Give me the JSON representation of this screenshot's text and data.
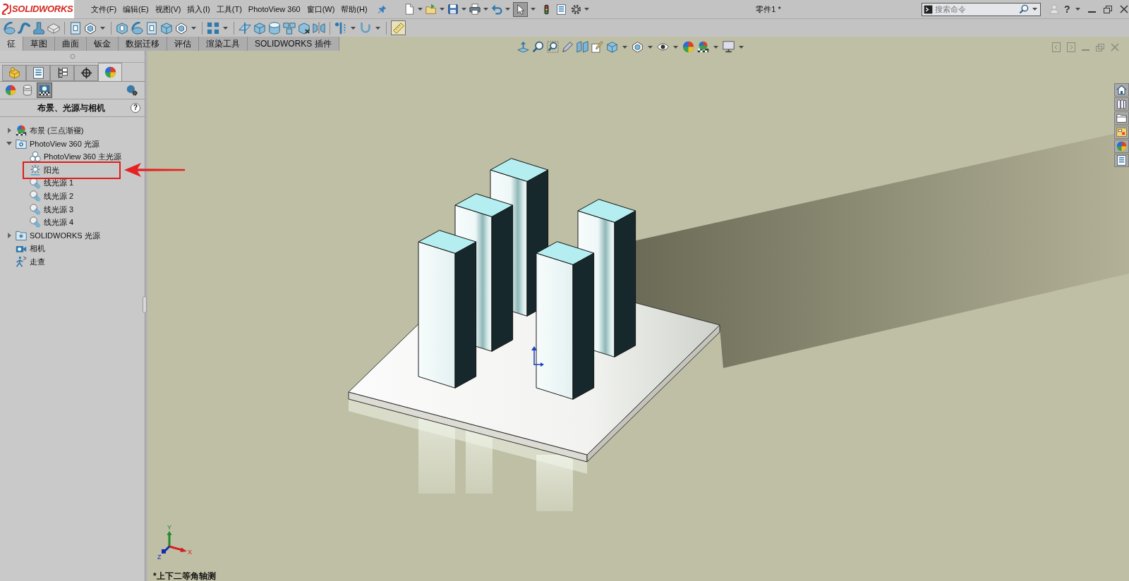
{
  "window": {
    "brand": "SOLIDWORKS",
    "title": "零件1 *"
  },
  "menu": [
    "文件(F)",
    "编辑(E)",
    "视图(V)",
    "插入(I)",
    "工具(T)",
    "PhotoView 360",
    "窗口(W)",
    "帮助(H)"
  ],
  "select_button": {
    "pressed": true
  },
  "search": {
    "placeholder": "搜索命令"
  },
  "help_menu": "?",
  "toggle_button": {
    "pressed": true
  },
  "command_tabs": [
    {
      "label": "征",
      "selected": true
    },
    {
      "label": "草图",
      "selected": false
    },
    {
      "label": "曲面",
      "selected": false
    },
    {
      "label": "钣金",
      "selected": false
    },
    {
      "label": "数据迁移",
      "selected": false
    },
    {
      "label": "评估",
      "selected": false
    },
    {
      "label": "渲染工具",
      "selected": false
    },
    {
      "label": "SOLIDWORKS 插件",
      "selected": false
    }
  ],
  "scene_panel": {
    "tabs": [
      {
        "kind": "feature",
        "selected": false
      },
      {
        "kind": "property",
        "selected": false
      },
      {
        "kind": "configuration",
        "selected": false
      },
      {
        "kind": "dimension",
        "selected": false
      },
      {
        "kind": "display",
        "selected": true
      }
    ],
    "views": [
      {
        "kind": "appearance",
        "selected": false
      },
      {
        "kind": "decal",
        "selected": false
      },
      {
        "kind": "scene",
        "selected": true
      }
    ],
    "title": "布景、光源与相机",
    "help": "?",
    "tree": [
      {
        "label": "布景 (三点渐褪)",
        "kind": "scene",
        "expanded": false,
        "marked": false
      },
      {
        "label": "PhotoView 360 光源",
        "kind": "folder",
        "expanded": true,
        "marked": false,
        "children": [
          {
            "label": "PhotoView 360 主光源",
            "kind": "main_light",
            "marked": false
          },
          {
            "label": "阳光",
            "kind": "sun",
            "marked": true
          },
          {
            "label": "线光源 1",
            "kind": "spot",
            "marked": false
          },
          {
            "label": "线光源 2",
            "kind": "spot",
            "marked": false
          },
          {
            "label": "线光源 3",
            "kind": "spot",
            "marked": false
          },
          {
            "label": "线光源 4",
            "kind": "spot",
            "marked": false
          }
        ]
      },
      {
        "label": "SOLIDWORKS 光源",
        "kind": "sun_folder",
        "expanded": false,
        "marked": false
      },
      {
        "label": "相机",
        "kind": "camera",
        "marked": false
      },
      {
        "label": "走查",
        "kind": "walk",
        "marked": false
      }
    ]
  },
  "view": {
    "triad": {
      "x": "X",
      "y": "Y",
      "z": "Z"
    },
    "orientation": "*上下二等角轴测"
  }
}
